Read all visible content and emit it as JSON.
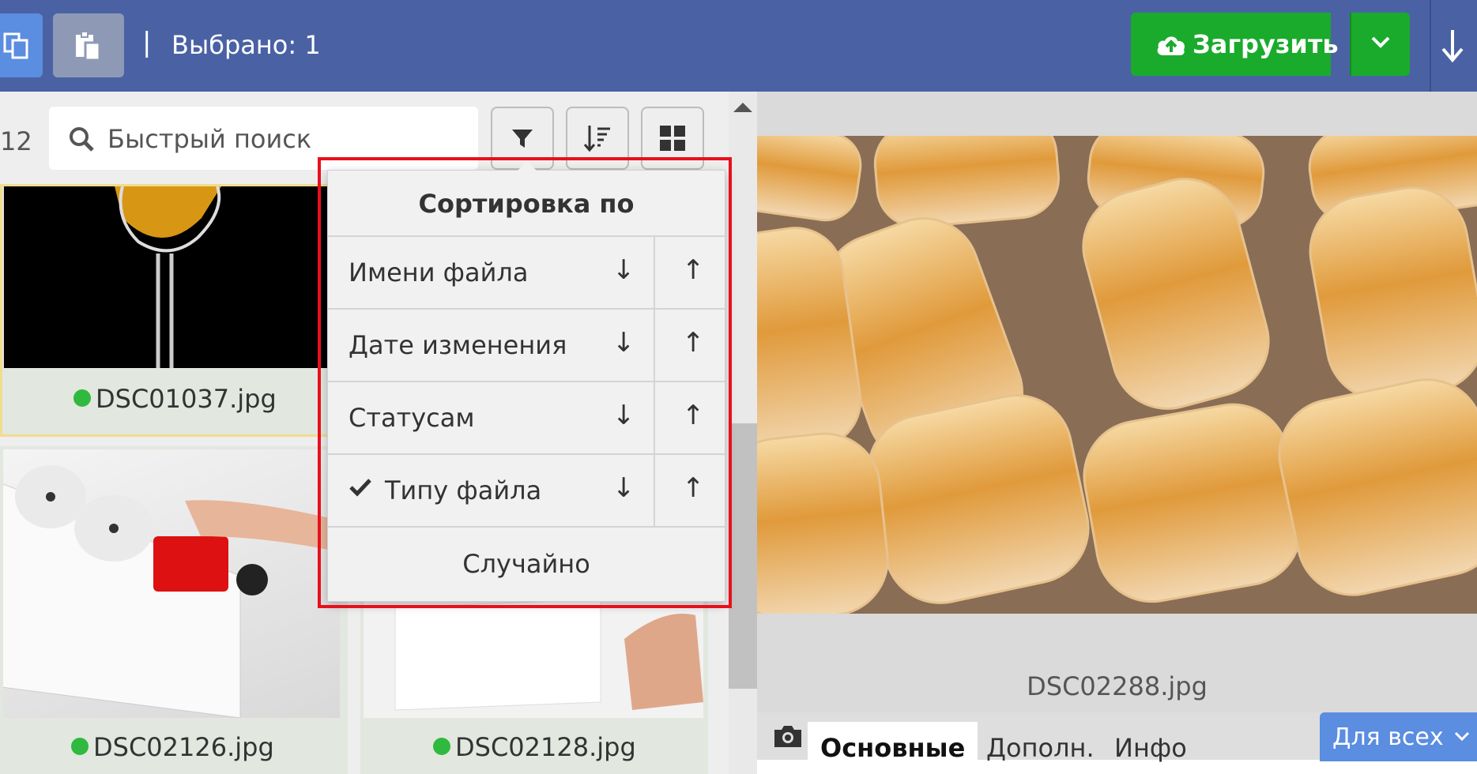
{
  "toolbar": {
    "selected_label": "Выбрано: 1",
    "separator": "|",
    "upload_label": "Загрузить",
    "icons": [
      "copy-icon",
      "paste-icon",
      "cloud-upload-icon",
      "chevron-down-icon",
      "download-arrow-icon"
    ],
    "colors": {
      "topbar": "#4a62a4",
      "upload": "#1aab2c",
      "accent": "#5b8de0"
    }
  },
  "library": {
    "count": "12",
    "search_placeholder": "Быстрый поиск",
    "tools": [
      "filter-icon",
      "sort-icon",
      "grid-view-icon"
    ],
    "thumbnails": [
      {
        "file": "DSC01037.jpg",
        "status": "green"
      },
      {
        "file": "DSC02126.jpg",
        "status": "green"
      },
      {
        "file": "DSC02128.jpg",
        "status": "green"
      }
    ]
  },
  "sort_menu": {
    "title": "Сортировка по",
    "options": [
      {
        "label": "Имени файла",
        "checked": false
      },
      {
        "label": "Дате изменения",
        "checked": false
      },
      {
        "label": "Статусам",
        "checked": false
      },
      {
        "label": "Типу файла",
        "checked": true
      }
    ],
    "down_arrow": "↓",
    "up_arrow": "↑",
    "random_label": "Случайно",
    "highlight_color": "#e8101c"
  },
  "preview": {
    "file": "DSC02288.jpg"
  },
  "tabs": {
    "items": [
      "Основные",
      "Дополн.",
      "Инфо"
    ],
    "active": "Основные",
    "for_all_label": "Для всех"
  }
}
